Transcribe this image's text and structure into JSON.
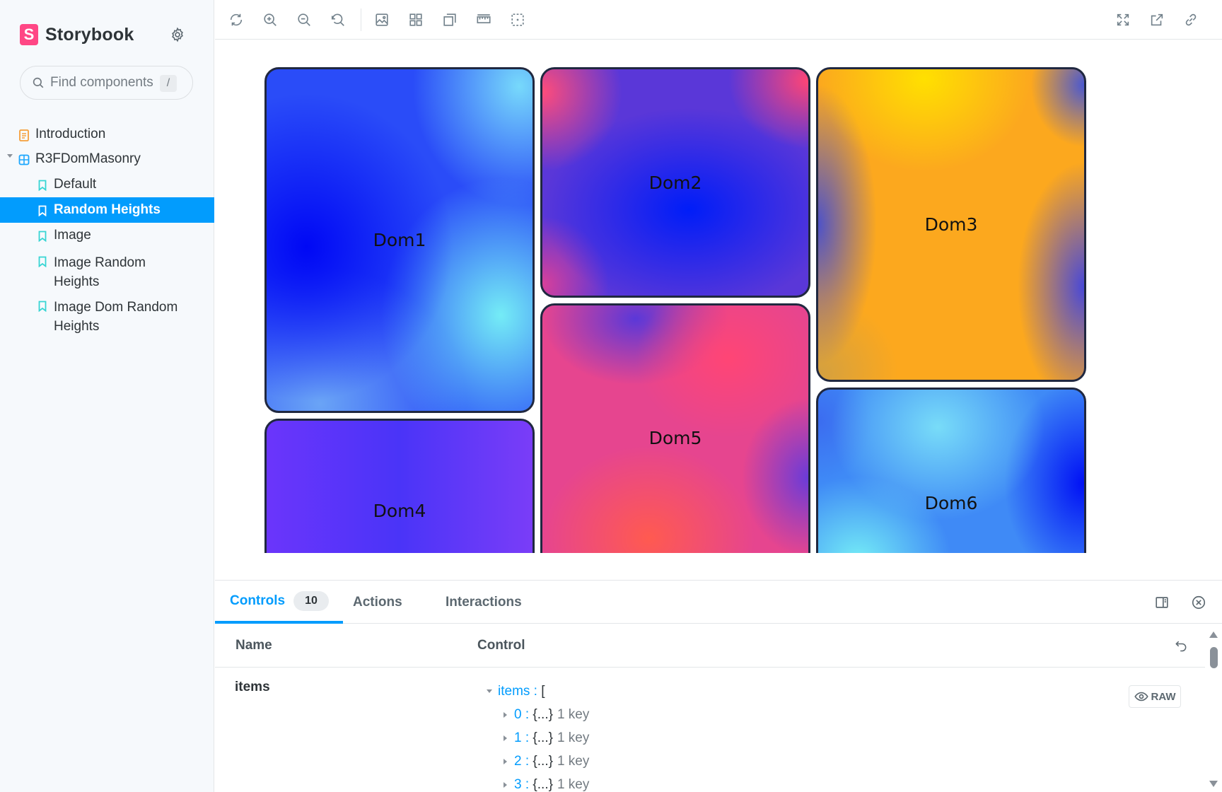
{
  "sidebar": {
    "brand": "Storybook",
    "brand_logo_letter": "S",
    "search_placeholder": "Find components",
    "search_shortcut": "/",
    "tree": [
      {
        "label": "Introduction",
        "icon": "document-icon"
      },
      {
        "label": "R3FDomMasonry",
        "icon": "component-icon"
      },
      {
        "label": "Default",
        "icon": "bookmark-icon"
      },
      {
        "label": "Random Heights",
        "icon": "bookmark-icon",
        "selected": true
      },
      {
        "label": "Image",
        "icon": "bookmark-icon"
      },
      {
        "label": "Image Random Heights",
        "icon": "bookmark-icon"
      },
      {
        "label": "Image Dom Random Heights",
        "icon": "bookmark-icon"
      }
    ]
  },
  "toolbar": {
    "left_icons": [
      "reload-icon",
      "zoom-in-icon",
      "zoom-out-icon",
      "zoom-reset-icon",
      "background-icon",
      "grid-icon",
      "outline-icon",
      "measure-icon",
      "viewport-icon"
    ],
    "right_icons": [
      "fullscreen-icon",
      "open-new-tab-icon",
      "copy-link-icon"
    ]
  },
  "canvas": {
    "tiles": [
      {
        "label": "Dom1"
      },
      {
        "label": "Dom2"
      },
      {
        "label": "Dom3"
      },
      {
        "label": "Dom4"
      },
      {
        "label": "Dom5"
      },
      {
        "label": "Dom6"
      }
    ]
  },
  "panel": {
    "tabs": [
      {
        "label": "Controls",
        "badge": "10",
        "active": true
      },
      {
        "label": "Actions"
      },
      {
        "label": "Interactions"
      }
    ],
    "header": {
      "name": "Name",
      "control": "Control"
    },
    "row": {
      "name": "items",
      "root_key": "items",
      "root_sep": " : ",
      "root_open": "[",
      "children": [
        {
          "key": "0",
          "value": "{...}",
          "meta": "1 key"
        },
        {
          "key": "1",
          "value": "{...}",
          "meta": "1 key"
        },
        {
          "key": "2",
          "value": "{...}",
          "meta": "1 key"
        },
        {
          "key": "3",
          "value": "{...}",
          "meta": "1 key"
        }
      ],
      "raw_label": "RAW"
    }
  },
  "colors": {
    "accent": "#029cfd",
    "brand": "#ff4785",
    "tile_border": "#202840"
  }
}
